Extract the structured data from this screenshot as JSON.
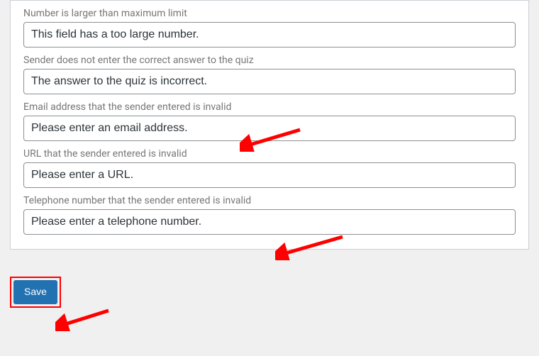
{
  "fields": [
    {
      "label": "Number is larger than maximum limit",
      "value": "This field has a too large number."
    },
    {
      "label": "Sender does not enter the correct answer to the quiz",
      "value": "The answer to the quiz is incorrect."
    },
    {
      "label": "Email address that the sender entered is invalid",
      "value": "Please enter an email address."
    },
    {
      "label": "URL that the sender entered is invalid",
      "value": "Please enter a URL."
    },
    {
      "label": "Telephone number that the sender entered is invalid",
      "value": "Please enter a telephone number."
    }
  ],
  "buttons": {
    "save": "Save"
  }
}
